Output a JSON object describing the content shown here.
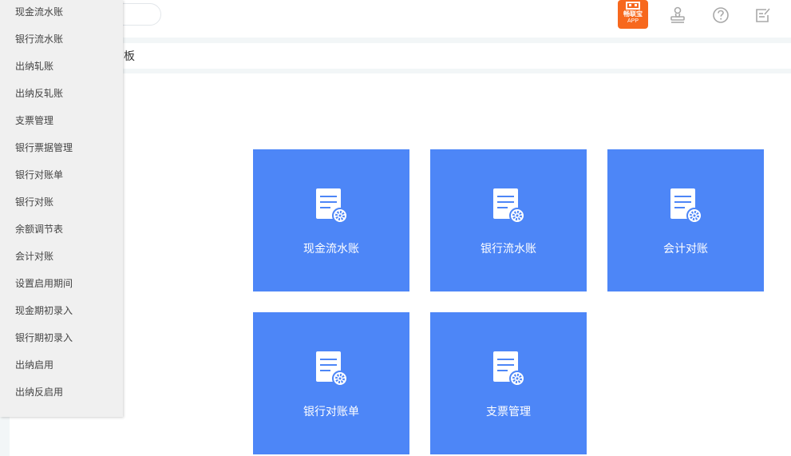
{
  "header": {
    "app_badge": {
      "name": "畅联宝",
      "sub": "APP"
    },
    "icons": [
      "stamp-icon",
      "help-icon",
      "edit-note-icon"
    ]
  },
  "tab": {
    "label": "板"
  },
  "dropdown": {
    "items": [
      {
        "label": "现金流水账"
      },
      {
        "label": "银行流水账"
      },
      {
        "label": "出纳轧账"
      },
      {
        "label": "出纳反轧账"
      },
      {
        "label": "支票管理"
      },
      {
        "label": "银行票据管理"
      },
      {
        "label": "银行对账单"
      },
      {
        "label": "银行对账"
      },
      {
        "label": "余额调节表"
      },
      {
        "label": "会计对账"
      },
      {
        "label": "设置启用期间"
      },
      {
        "label": "现金期初录入"
      },
      {
        "label": "银行期初录入"
      },
      {
        "label": "出纳启用"
      },
      {
        "label": "出纳反启用"
      }
    ]
  },
  "tiles": [
    {
      "label": "现金流水账",
      "icon": "document-settings-icon"
    },
    {
      "label": "银行流水账",
      "icon": "document-settings-icon"
    },
    {
      "label": "会计对账",
      "icon": "document-settings-icon"
    },
    {
      "label": "银行对账单",
      "icon": "document-settings-icon"
    },
    {
      "label": "支票管理",
      "icon": "document-settings-icon"
    }
  ],
  "colors": {
    "tile": "#4d86f7",
    "badge": "#f7681d",
    "menu_bg": "#f0f0f0"
  }
}
